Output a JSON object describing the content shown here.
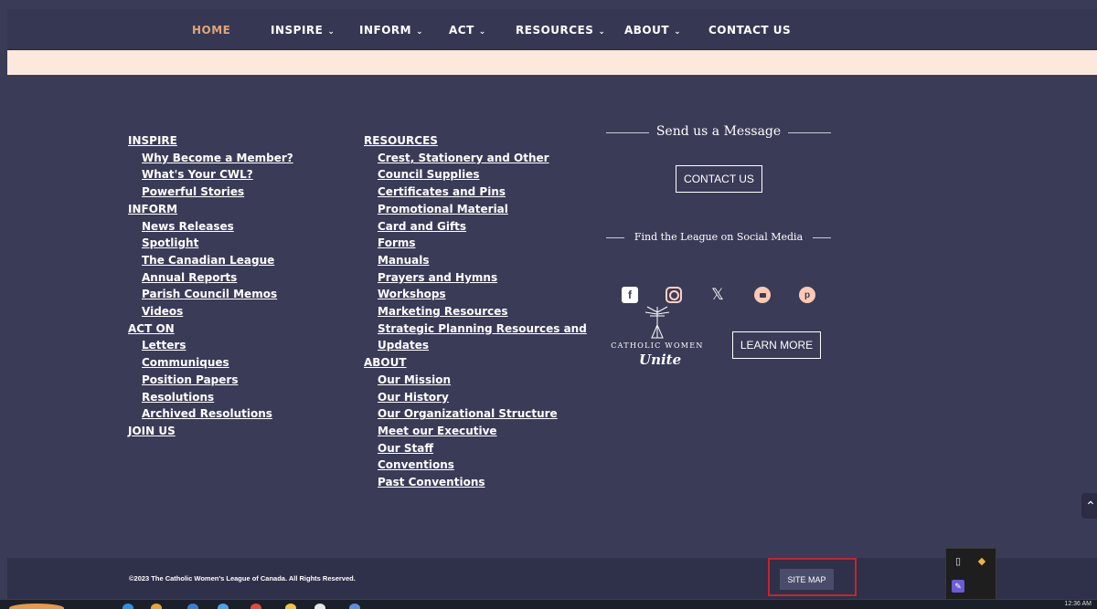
{
  "nav": {
    "items": [
      {
        "label": "HOME",
        "chevron": false,
        "active": true
      },
      {
        "label": "INSPIRE",
        "chevron": true
      },
      {
        "label": "INFORM",
        "chevron": true
      },
      {
        "label": "ACT",
        "chevron": true
      },
      {
        "label": "RESOURCES",
        "chevron": true
      },
      {
        "label": "ABOUT",
        "chevron": true
      },
      {
        "label": "CONTACT US",
        "chevron": false
      }
    ],
    "chevron_glyph": "⌄"
  },
  "footer": {
    "col1": {
      "inspire": "INSPIRE",
      "inspire_items": [
        "Why Become a Member?",
        "What's Your CWL?",
        "Powerful Stories"
      ],
      "inform": "INFORM",
      "inform_items": [
        "News Releases",
        "Spotlight",
        "The Canadian League",
        "Annual Reports",
        "Parish Council Memos",
        "Videos"
      ],
      "act_on": "ACT ON",
      "act_items": [
        "Letters",
        "Communiques",
        "Position Papers",
        "Resolutions",
        "Archived Resolutions"
      ],
      "join_us": "JOIN US"
    },
    "col2": {
      "resources": "RESOURCES",
      "resources_items": [
        "Crest, Stationery and Other",
        "Council Supplies",
        "Certificates and Pins",
        "Promotional Material",
        "Card and Gifts",
        "Forms",
        "Manuals",
        "Prayers and Hymns",
        "Workshops",
        "Marketing Resources",
        "Strategic Planning Resources and",
        "Updates"
      ],
      "about": "ABOUT",
      "about_items": [
        "Our Mission",
        "Our History",
        "Our Organizational Structure",
        "Meet our Executive",
        "Our Staff",
        "Conventions",
        "Past Conventions"
      ]
    },
    "message_title": "Send us a Message",
    "contact_button": "CONTACT US",
    "social_title": "Find the League on Social Media",
    "social_icons": [
      "facebook-icon",
      "instagram-icon",
      "x-icon",
      "youtube-icon",
      "pinterest-icon"
    ],
    "cwu_logo_line1": "CATHOLIC WOMEN",
    "cwu_logo_line2": "Unite",
    "learn_more_button": "LEARN MORE"
  },
  "bottom": {
    "copyright": "©2023 The Catholic Women's League of Canada. All Rights Reserved.",
    "site_map": "SITE MAP"
  },
  "taskbar": {
    "clock": "12:36 AM"
  },
  "colors": {
    "nav_bg": "#363853",
    "footer_bg": "#3a3b57",
    "active_nav": "#e0a47a",
    "peach_band": "#fde8dc",
    "highlight_red": "#c8232c"
  }
}
